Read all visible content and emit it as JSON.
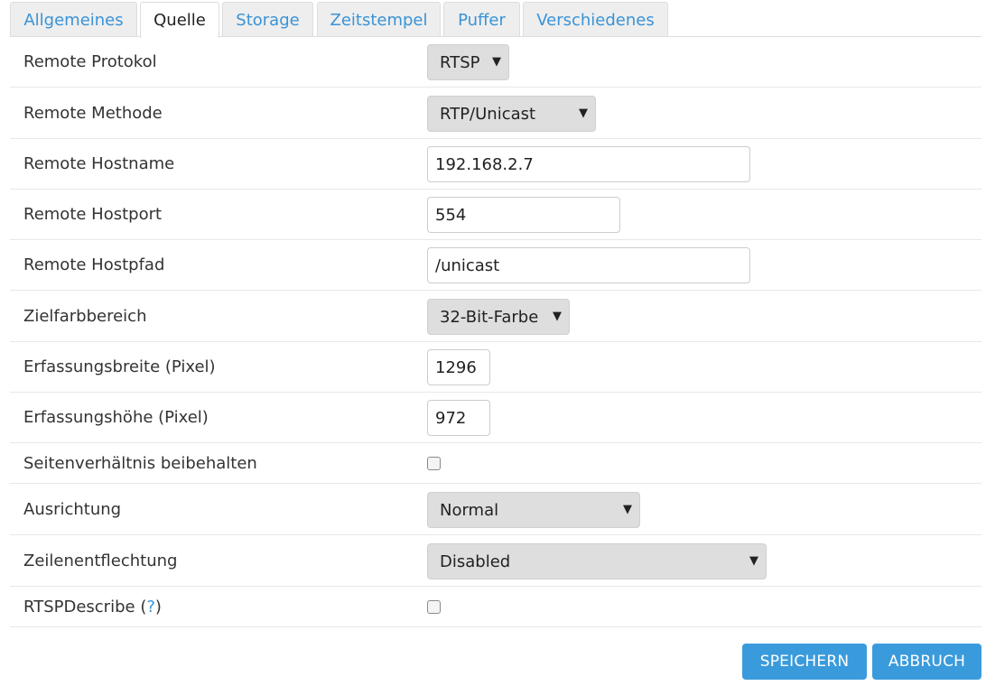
{
  "tabs": [
    {
      "label": "Allgemeines"
    },
    {
      "label": "Quelle"
    },
    {
      "label": "Storage"
    },
    {
      "label": "Zeitstempel"
    },
    {
      "label": "Puffer"
    },
    {
      "label": "Verschiedenes"
    }
  ],
  "active_tab": "Quelle",
  "fields": {
    "remote_protokoll": {
      "label": "Remote Protokol",
      "value": "RTSP"
    },
    "remote_methode": {
      "label": "Remote Methode",
      "value": "RTP/Unicast"
    },
    "remote_hostname": {
      "label": "Remote Hostname",
      "value": "192.168.2.7"
    },
    "remote_hostport": {
      "label": "Remote Hostport",
      "value": "554"
    },
    "remote_hostpfad": {
      "label": "Remote Hostpfad",
      "value": "/unicast"
    },
    "zielfarbbereich": {
      "label": "Zielfarbbereich",
      "value": "32-Bit-Farbe"
    },
    "erfassungsbreite": {
      "label": "Erfassungsbreite (Pixel)",
      "value": "1296"
    },
    "erfassungshoehe": {
      "label": "Erfassungshöhe (Pixel)",
      "value": "972"
    },
    "seitenverhaeltnis": {
      "label": "Seitenverhältnis beibehalten",
      "checked": false
    },
    "ausrichtung": {
      "label": "Ausrichtung",
      "value": "Normal"
    },
    "zeilenentflechtung": {
      "label": "Zeilenentflechtung",
      "value": "Disabled"
    },
    "rtspdescribe": {
      "label": "RTSPDescribe",
      "help": "?",
      "checked": false
    }
  },
  "buttons": {
    "save": "SPEICHERN",
    "cancel": "ABBRUCH"
  },
  "icons": {
    "caret": "▼"
  },
  "colors": {
    "accent": "#3a9bdc",
    "tab_text": "#3a93d6"
  }
}
